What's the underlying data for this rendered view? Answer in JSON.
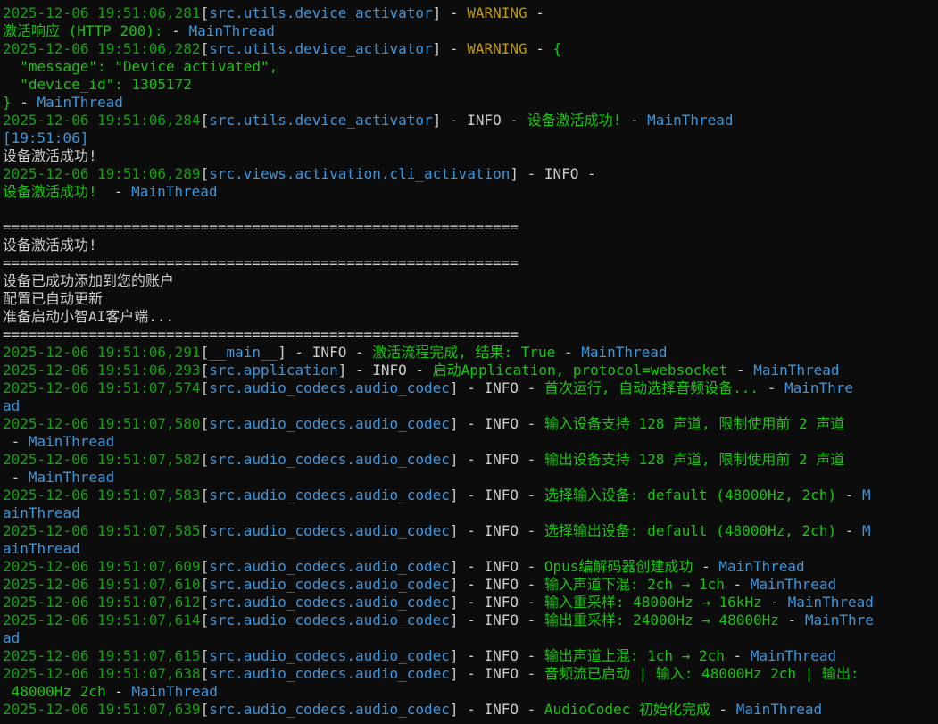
{
  "lines": [
    [
      [
        "ts",
        "2025-12-06 19:51:06,281"
      ],
      [
        "br",
        "["
      ],
      [
        "mod",
        "src.utils.device_activator"
      ],
      [
        "br",
        "] - "
      ],
      [
        "lvl-warn",
        "WARNING"
      ],
      [
        "br",
        " -"
      ]
    ],
    [
      [
        "msg-green",
        "激活响应 (HTTP 200): "
      ],
      [
        "br",
        "- "
      ],
      [
        "msg-cyan",
        "MainThread"
      ]
    ],
    [
      [
        "ts",
        "2025-12-06 19:51:06,282"
      ],
      [
        "br",
        "["
      ],
      [
        "mod",
        "src.utils.device_activator"
      ],
      [
        "br",
        "] - "
      ],
      [
        "lvl-warn",
        "WARNING"
      ],
      [
        "br",
        " - "
      ],
      [
        "msg-green",
        "{"
      ]
    ],
    [
      [
        "msg-green",
        "  \"message\": \"Device activated\","
      ]
    ],
    [
      [
        "msg-green",
        "  \"device_id\": 1305172"
      ]
    ],
    [
      [
        "msg-green",
        "}"
      ],
      [
        "br",
        " - "
      ],
      [
        "msg-cyan",
        "MainThread"
      ]
    ],
    [
      [
        "ts",
        "2025-12-06 19:51:06,284"
      ],
      [
        "br",
        "["
      ],
      [
        "mod",
        "src.utils.device_activator"
      ],
      [
        "br",
        "] - "
      ],
      [
        "lvl",
        "INFO"
      ],
      [
        "br",
        " - "
      ],
      [
        "msg-green",
        "设备激活成功!"
      ],
      [
        "br",
        " - "
      ],
      [
        "msg-cyan",
        "MainThread"
      ]
    ],
    [
      [
        "msg-cyan",
        "[19:51:06]"
      ]
    ],
    [
      [
        "msg-white",
        "设备激活成功!"
      ]
    ],
    [
      [
        "ts",
        "2025-12-06 19:51:06,289"
      ],
      [
        "br",
        "["
      ],
      [
        "mod",
        "src.views.activation.cli_activation"
      ],
      [
        "br",
        "] - "
      ],
      [
        "lvl",
        "INFO"
      ],
      [
        "br",
        " -"
      ]
    ],
    [
      [
        "msg-green",
        "设备激活成功!"
      ],
      [
        "br",
        "  - "
      ],
      [
        "msg-cyan",
        "MainThread"
      ]
    ],
    [
      [
        "msg-white",
        ""
      ]
    ],
    [
      [
        "sep-line",
        "============================================================"
      ]
    ],
    [
      [
        "msg-white",
        "设备激活成功!"
      ]
    ],
    [
      [
        "sep-line",
        "============================================================"
      ]
    ],
    [
      [
        "msg-white",
        "设备已成功添加到您的账户"
      ]
    ],
    [
      [
        "msg-white",
        "配置已自动更新"
      ]
    ],
    [
      [
        "msg-white",
        "准备启动小智AI客户端..."
      ]
    ],
    [
      [
        "sep-line",
        "============================================================"
      ]
    ],
    [
      [
        "ts",
        "2025-12-06 19:51:06,291"
      ],
      [
        "br",
        "["
      ],
      [
        "mod",
        "__main__"
      ],
      [
        "br",
        "] - "
      ],
      [
        "lvl",
        "INFO"
      ],
      [
        "br",
        " - "
      ],
      [
        "msg-green",
        "激活流程完成, 结果: True"
      ],
      [
        "br",
        " - "
      ],
      [
        "msg-cyan",
        "MainThread"
      ]
    ],
    [
      [
        "ts",
        "2025-12-06 19:51:06,293"
      ],
      [
        "br",
        "["
      ],
      [
        "mod",
        "src.application"
      ],
      [
        "br",
        "] - "
      ],
      [
        "lvl",
        "INFO"
      ],
      [
        "br",
        " - "
      ],
      [
        "msg-green",
        "启动Application, protocol=websocket"
      ],
      [
        "br",
        " - "
      ],
      [
        "msg-cyan",
        "MainThread"
      ]
    ],
    [
      [
        "ts",
        "2025-12-06 19:51:07,574"
      ],
      [
        "br",
        "["
      ],
      [
        "mod",
        "src.audio_codecs.audio_codec"
      ],
      [
        "br",
        "] - "
      ],
      [
        "lvl",
        "INFO"
      ],
      [
        "br",
        " - "
      ],
      [
        "msg-green",
        "首次运行, 自动选择音频设备..."
      ],
      [
        "br",
        " - "
      ],
      [
        "msg-cyan",
        "MainThre"
      ]
    ],
    [
      [
        "msg-cyan",
        "ad"
      ]
    ],
    [
      [
        "ts",
        "2025-12-06 19:51:07,580"
      ],
      [
        "br",
        "["
      ],
      [
        "mod",
        "src.audio_codecs.audio_codec"
      ],
      [
        "br",
        "] - "
      ],
      [
        "lvl",
        "INFO"
      ],
      [
        "br",
        " - "
      ],
      [
        "msg-green",
        "输入设备支持 128 声道, 限制使用前 2 声道"
      ]
    ],
    [
      [
        "br",
        " - "
      ],
      [
        "msg-cyan",
        "MainThread"
      ]
    ],
    [
      [
        "ts",
        "2025-12-06 19:51:07,582"
      ],
      [
        "br",
        "["
      ],
      [
        "mod",
        "src.audio_codecs.audio_codec"
      ],
      [
        "br",
        "] - "
      ],
      [
        "lvl",
        "INFO"
      ],
      [
        "br",
        " - "
      ],
      [
        "msg-green",
        "输出设备支持 128 声道, 限制使用前 2 声道"
      ]
    ],
    [
      [
        "br",
        " - "
      ],
      [
        "msg-cyan",
        "MainThread"
      ]
    ],
    [
      [
        "ts",
        "2025-12-06 19:51:07,583"
      ],
      [
        "br",
        "["
      ],
      [
        "mod",
        "src.audio_codecs.audio_codec"
      ],
      [
        "br",
        "] - "
      ],
      [
        "lvl",
        "INFO"
      ],
      [
        "br",
        " - "
      ],
      [
        "msg-green",
        "选择输入设备: default (48000Hz, 2ch)"
      ],
      [
        "br",
        " - "
      ],
      [
        "msg-cyan",
        "M"
      ]
    ],
    [
      [
        "msg-cyan",
        "ainThread"
      ]
    ],
    [
      [
        "ts",
        "2025-12-06 19:51:07,585"
      ],
      [
        "br",
        "["
      ],
      [
        "mod",
        "src.audio_codecs.audio_codec"
      ],
      [
        "br",
        "] - "
      ],
      [
        "lvl",
        "INFO"
      ],
      [
        "br",
        " - "
      ],
      [
        "msg-green",
        "选择输出设备: default (48000Hz, 2ch)"
      ],
      [
        "br",
        " - "
      ],
      [
        "msg-cyan",
        "M"
      ]
    ],
    [
      [
        "msg-cyan",
        "ainThread"
      ]
    ],
    [
      [
        "ts",
        "2025-12-06 19:51:07,609"
      ],
      [
        "br",
        "["
      ],
      [
        "mod",
        "src.audio_codecs.audio_codec"
      ],
      [
        "br",
        "] - "
      ],
      [
        "lvl",
        "INFO"
      ],
      [
        "br",
        " - "
      ],
      [
        "msg-green",
        "Opus编解码器创建成功"
      ],
      [
        "br",
        " - "
      ],
      [
        "msg-cyan",
        "MainThread"
      ]
    ],
    [
      [
        "ts",
        "2025-12-06 19:51:07,610"
      ],
      [
        "br",
        "["
      ],
      [
        "mod",
        "src.audio_codecs.audio_codec"
      ],
      [
        "br",
        "] - "
      ],
      [
        "lvl",
        "INFO"
      ],
      [
        "br",
        " - "
      ],
      [
        "msg-green",
        "输入声道下混: 2ch → 1ch"
      ],
      [
        "br",
        " - "
      ],
      [
        "msg-cyan",
        "MainThread"
      ]
    ],
    [
      [
        "ts",
        "2025-12-06 19:51:07,612"
      ],
      [
        "br",
        "["
      ],
      [
        "mod",
        "src.audio_codecs.audio_codec"
      ],
      [
        "br",
        "] - "
      ],
      [
        "lvl",
        "INFO"
      ],
      [
        "br",
        " - "
      ],
      [
        "msg-green",
        "输入重采样: 48000Hz → 16kHz"
      ],
      [
        "br",
        " - "
      ],
      [
        "msg-cyan",
        "MainThread"
      ]
    ],
    [
      [
        "ts",
        "2025-12-06 19:51:07,614"
      ],
      [
        "br",
        "["
      ],
      [
        "mod",
        "src.audio_codecs.audio_codec"
      ],
      [
        "br",
        "] - "
      ],
      [
        "lvl",
        "INFO"
      ],
      [
        "br",
        " - "
      ],
      [
        "msg-green",
        "输出重采样: 24000Hz → 48000Hz"
      ],
      [
        "br",
        " - "
      ],
      [
        "msg-cyan",
        "MainThre"
      ]
    ],
    [
      [
        "msg-cyan",
        "ad"
      ]
    ],
    [
      [
        "ts",
        "2025-12-06 19:51:07,615"
      ],
      [
        "br",
        "["
      ],
      [
        "mod",
        "src.audio_codecs.audio_codec"
      ],
      [
        "br",
        "] - "
      ],
      [
        "lvl",
        "INFO"
      ],
      [
        "br",
        " - "
      ],
      [
        "msg-green",
        "输出声道上混: 1ch → 2ch"
      ],
      [
        "br",
        " - "
      ],
      [
        "msg-cyan",
        "MainThread"
      ]
    ],
    [
      [
        "ts",
        "2025-12-06 19:51:07,638"
      ],
      [
        "br",
        "["
      ],
      [
        "mod",
        "src.audio_codecs.audio_codec"
      ],
      [
        "br",
        "] - "
      ],
      [
        "lvl",
        "INFO"
      ],
      [
        "br",
        " - "
      ],
      [
        "msg-green",
        "音频流已启动 | 输入: 48000Hz 2ch | 输出:"
      ]
    ],
    [
      [
        "msg-green",
        " 48000Hz 2ch"
      ],
      [
        "br",
        " - "
      ],
      [
        "msg-cyan",
        "MainThread"
      ]
    ],
    [
      [
        "ts",
        "2025-12-06 19:51:07,639"
      ],
      [
        "br",
        "["
      ],
      [
        "mod",
        "src.audio_codecs.audio_codec"
      ],
      [
        "br",
        "] - "
      ],
      [
        "lvl",
        "INFO"
      ],
      [
        "br",
        " - "
      ],
      [
        "msg-green",
        "AudioCodec 初始化完成"
      ],
      [
        "br",
        " - "
      ],
      [
        "msg-cyan",
        "MainThread"
      ]
    ]
  ]
}
